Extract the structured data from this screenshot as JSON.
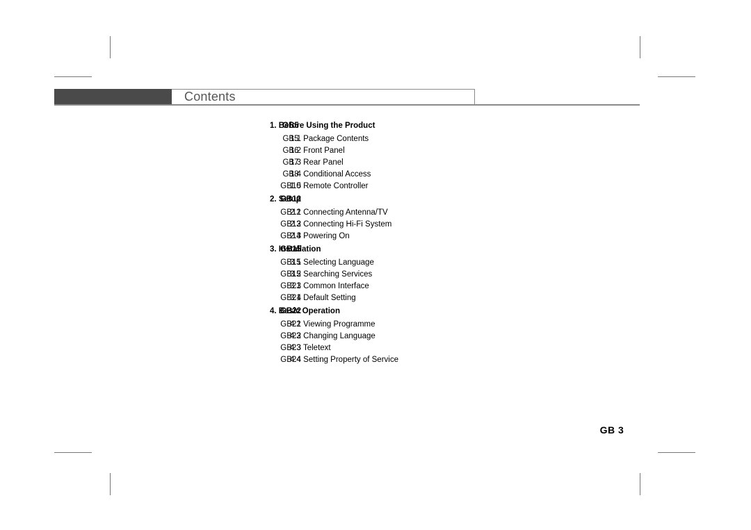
{
  "header": {
    "title": "Contents"
  },
  "toc": {
    "entries": [
      {
        "kind": "section",
        "label": "1. Before Using the Product",
        "page": "GB5"
      },
      {
        "kind": "item",
        "label": "1.1 Package Contents",
        "page": "GB5"
      },
      {
        "kind": "item",
        "label": "1.2 Front Panel",
        "page": "GB6"
      },
      {
        "kind": "item",
        "label": "1.3 Rear Panel",
        "page": "GB7"
      },
      {
        "kind": "item",
        "label": "1.4 Conditional Access",
        "page": "GB8"
      },
      {
        "kind": "item",
        "label": "1.5 Remote Controller",
        "page": "GB10"
      },
      {
        "kind": "section",
        "label": "2. Setup",
        "page": "GB12"
      },
      {
        "kind": "item",
        "label": "2.1 Connecting Antenna/TV",
        "page": "GB12"
      },
      {
        "kind": "item",
        "label": "2.2 Connecting Hi-Fi System",
        "page": "GB13"
      },
      {
        "kind": "item",
        "label": "2.3 Powering On",
        "page": "GB14"
      },
      {
        "kind": "section",
        "label": "3. Installation",
        "page": "GB15"
      },
      {
        "kind": "item",
        "label": "3.1 Selecting Language",
        "page": "GB15"
      },
      {
        "kind": "item",
        "label": "3.2 Searching Services",
        "page": "GB15"
      },
      {
        "kind": "item",
        "label": "3.3 Common Interface",
        "page": "GB21"
      },
      {
        "kind": "item",
        "label": "3.4 Default Setting",
        "page": "GB21"
      },
      {
        "kind": "section",
        "label": "4. Basic Operation",
        "page": "GB22"
      },
      {
        "kind": "item",
        "label": "4.1 Viewing Programme",
        "page": "GB22"
      },
      {
        "kind": "item",
        "label": "4.2 Changing Language",
        "page": "GB23"
      },
      {
        "kind": "item",
        "label": "4.3 Teletext",
        "page": "GB23"
      },
      {
        "kind": "item",
        "label": "4.4 Setting Property of Service",
        "page": "GB24"
      }
    ]
  },
  "footer": {
    "page_number": "GB 3"
  },
  "colors": {
    "header_block": "#4a4a4a",
    "header_border": "#8a8a8a",
    "header_title": "#565656",
    "crop_mark": "#777777",
    "text": "#000000",
    "page_background": "#ffffff"
  }
}
